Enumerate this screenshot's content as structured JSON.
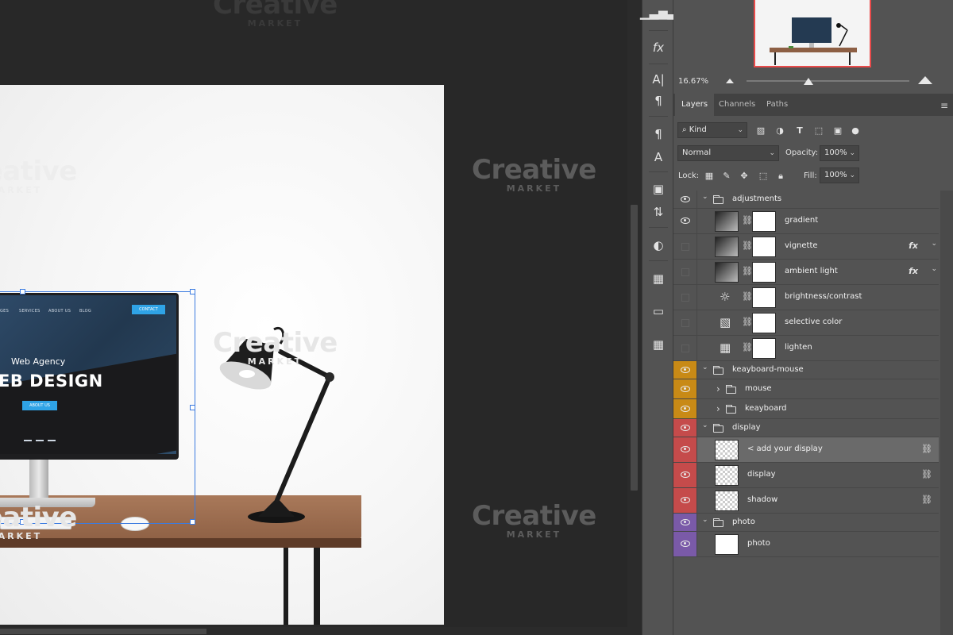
{
  "screen_mockup": {
    "nav": [
      "GES",
      "SERVICES",
      "ABOUT US",
      "BLOG"
    ],
    "contact": "CONTACT",
    "subtitle": "Web Agency",
    "title": "EB DESIGN",
    "about_button": "ABOUT US"
  },
  "watermark": {
    "title": "Creative",
    "subtitle": "MARKET"
  },
  "navigator": {
    "zoom": "16.67%"
  },
  "tabs": [
    {
      "label": "Layers",
      "active": true
    },
    {
      "label": "Channels",
      "active": false
    },
    {
      "label": "Paths",
      "active": false
    }
  ],
  "filter": {
    "kind_label": "Kind"
  },
  "blend": {
    "mode": "Normal",
    "opacity_label": "Opacity:",
    "opacity": "100%"
  },
  "lock": {
    "label": "Lock:",
    "fill_label": "Fill:",
    "fill": "100%"
  },
  "layers": [
    {
      "name": "adjustments",
      "type": "group",
      "visible": true,
      "color": "#535353",
      "indent": 0
    },
    {
      "name": "gradient",
      "type": "adjust-mask",
      "visible": true,
      "color": "#535353",
      "indent": 1
    },
    {
      "name": "vignette",
      "type": "adjust-mask",
      "visible": false,
      "color": "#535353",
      "indent": 1,
      "fx": true
    },
    {
      "name": "ambient light",
      "type": "adjust-mask",
      "visible": false,
      "color": "#535353",
      "indent": 1,
      "fx": true
    },
    {
      "name": "brightness/contrast",
      "type": "adjustment",
      "visible": false,
      "color": "#535353",
      "indent": 1
    },
    {
      "name": "selective color",
      "type": "adjustment",
      "visible": false,
      "color": "#535353",
      "indent": 1
    },
    {
      "name": "lighten",
      "type": "adjustment",
      "visible": false,
      "color": "#535353",
      "indent": 1
    },
    {
      "name": "keayboard-mouse",
      "type": "group",
      "visible": true,
      "color": "#c88a16",
      "indent": 0
    },
    {
      "name": "mouse",
      "type": "subgroup",
      "visible": true,
      "color": "#c88a16",
      "indent": 1
    },
    {
      "name": "keayboard",
      "type": "subgroup",
      "visible": true,
      "color": "#c88a16",
      "indent": 1
    },
    {
      "name": "display",
      "type": "group",
      "visible": true,
      "color": "#c54b4b",
      "indent": 0
    },
    {
      "name": "< add your display",
      "type": "smart",
      "visible": true,
      "color": "#c54b4b",
      "indent": 1,
      "selected": true,
      "linked": true
    },
    {
      "name": "display",
      "type": "smart",
      "visible": true,
      "color": "#c54b4b",
      "indent": 1,
      "linked": true
    },
    {
      "name": "shadow",
      "type": "smart",
      "visible": true,
      "color": "#c54b4b",
      "indent": 1,
      "linked": true
    },
    {
      "name": "photo",
      "type": "group",
      "visible": true,
      "color": "#7a5aa8",
      "indent": 0
    },
    {
      "name": "photo",
      "type": "pixel",
      "visible": true,
      "color": "#7a5aa8",
      "indent": 1
    }
  ]
}
